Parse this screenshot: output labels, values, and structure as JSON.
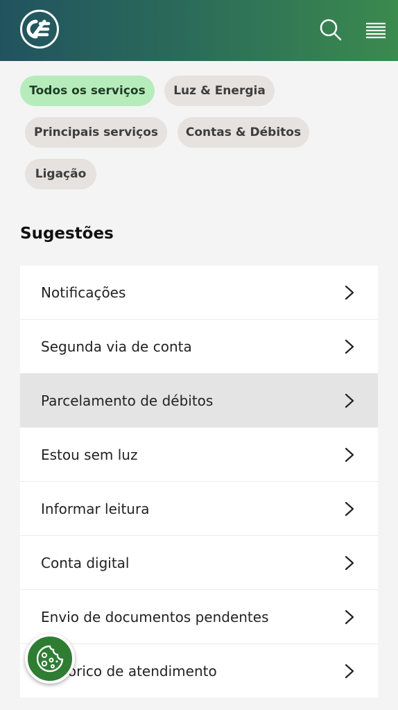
{
  "header": {
    "logo_icon": "brand-logo",
    "search_icon": "search-icon",
    "menu_icon": "hamburger-menu-icon",
    "colors": {
      "start": "#21535f",
      "end": "#3b8a4e"
    }
  },
  "filters": [
    {
      "label": "Todos os serviços",
      "active": true
    },
    {
      "label": "Luz & Energia",
      "active": false
    },
    {
      "label": "Principais serviços",
      "active": false
    },
    {
      "label": "Contas & Débitos",
      "active": false
    },
    {
      "label": "Ligação",
      "active": false
    }
  ],
  "suggestions": {
    "title": "Sugestões",
    "items": [
      {
        "label": "Notificações"
      },
      {
        "label": "Segunda via de conta"
      },
      {
        "label": "Parcelamento de débitos",
        "highlighted": true
      },
      {
        "label": "Estou sem luz"
      },
      {
        "label": "Informar leitura"
      },
      {
        "label": "Conta digital"
      },
      {
        "label": "Envio de documentos pendentes"
      },
      {
        "label": "Histórico de atendimento"
      }
    ]
  },
  "cookie_button": {
    "icon": "cookie-icon",
    "color": "#2f7d33"
  }
}
